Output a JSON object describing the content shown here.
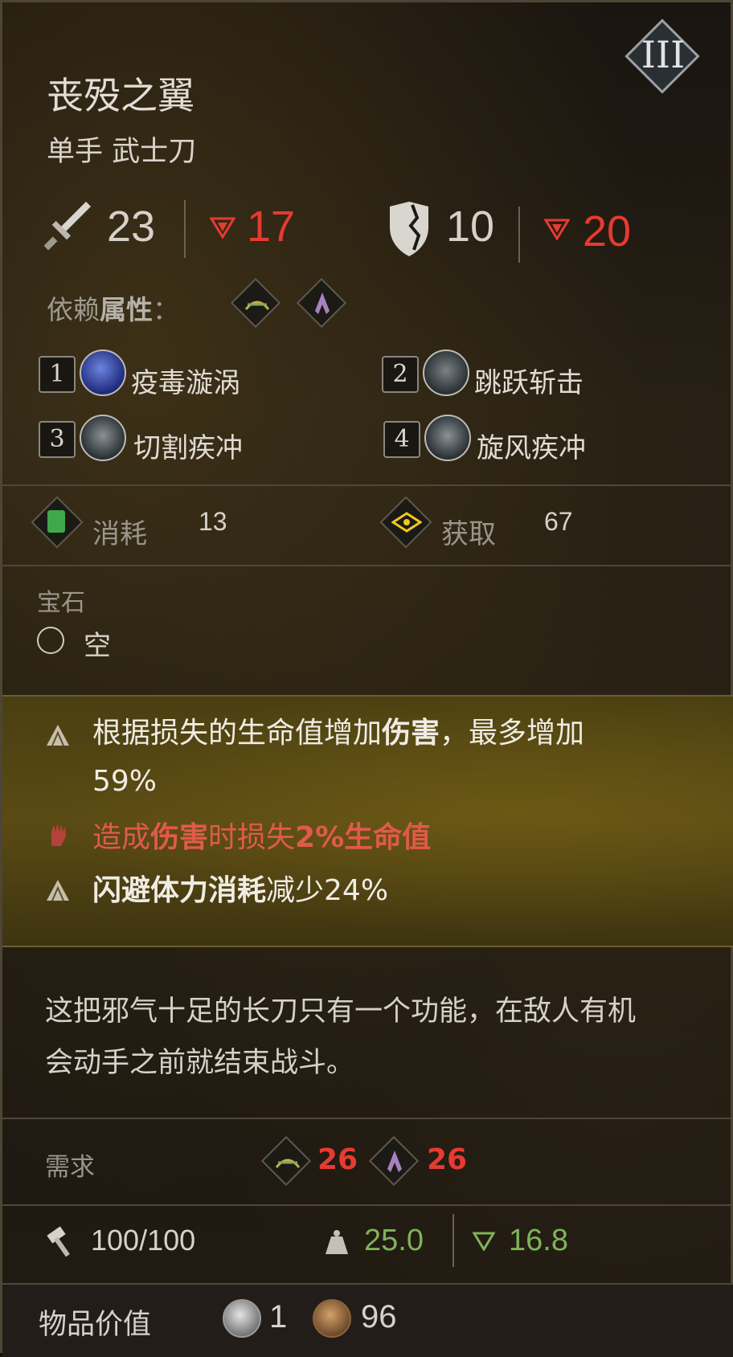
{
  "item": {
    "name": "丧殁之翼",
    "type": "单手 武士刀",
    "tier": "III"
  },
  "stats": {
    "attack": "23",
    "attack_penalty": "17",
    "defense": "10",
    "defense_penalty": "20"
  },
  "scaling": {
    "label_a": "依赖",
    "label_b": "属性",
    "label_c": "："
  },
  "skills": [
    {
      "num": "1",
      "name": "疫毒漩涡"
    },
    {
      "num": "2",
      "name": "跳跃斩击"
    },
    {
      "num": "3",
      "name": "切割疾冲"
    },
    {
      "num": "4",
      "name": "旋风疾冲"
    }
  ],
  "resources": {
    "consume_label": "消耗",
    "consume_value": "13",
    "gain_label": "获取",
    "gain_value": "67"
  },
  "gem": {
    "label": "宝石",
    "slot": "空"
  },
  "perks": {
    "p1_a": "根据损失的生命值增加",
    "p1_b": "伤害",
    "p1_c": "，最多增加",
    "p1_d": "59%",
    "p2_a": "造成",
    "p2_b": "伤害",
    "p2_c": "时损失",
    "p2_d": "2%生命值",
    "p3_a": "闪避体力消耗",
    "p3_b": "减少24%"
  },
  "description": {
    "line1": "这把邪气十足的长刀只有一个功能，在敌人有机",
    "line2": "会动手之前就结束战斗。"
  },
  "requirements": {
    "label": "需求",
    "req1": "26",
    "req2": "26"
  },
  "durability": {
    "value": "100/100",
    "weight": "25.0",
    "weight_mod": "16.8"
  },
  "value": {
    "label": "物品价值",
    "silver": "1",
    "bronze": "96"
  },
  "colors": {
    "penalty_red": "#e63a32",
    "weight_green": "#7fb35a",
    "gold_band": "#5a4a14"
  }
}
